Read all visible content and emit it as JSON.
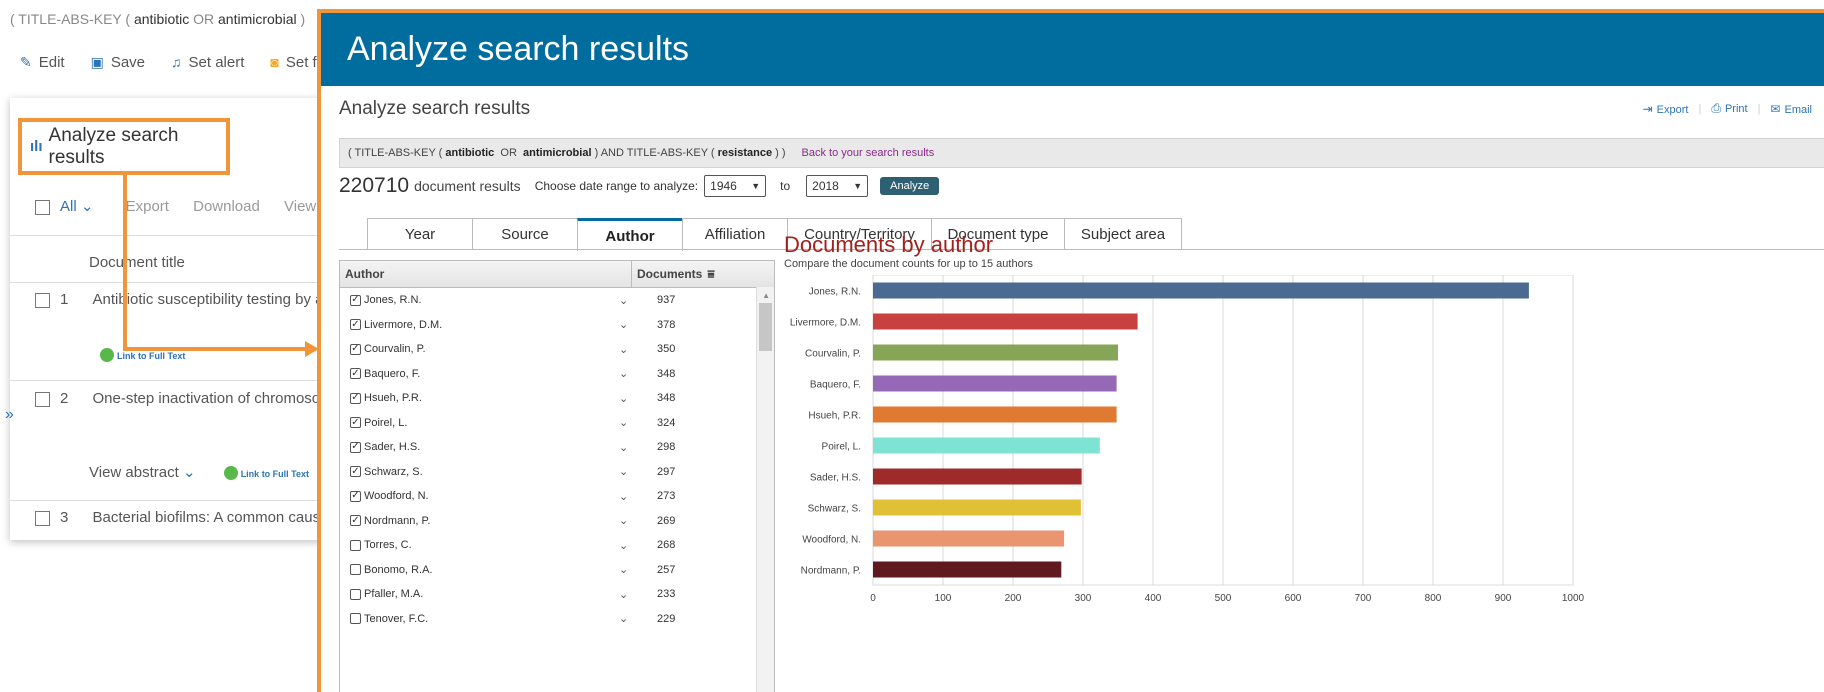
{
  "background": {
    "query_parts": [
      "( TITLE-ABS-KEY (",
      "antibiotic",
      "OR",
      "antimicrobial",
      ")"
    ],
    "toolbar": [
      {
        "icon": "pencil-icon",
        "label": "Edit"
      },
      {
        "icon": "save-icon",
        "label": "Save"
      },
      {
        "icon": "bell-icon",
        "label": "Set alert"
      },
      {
        "icon": "rss-icon",
        "label": "Set fe"
      }
    ],
    "analyze_link": "Analyze search results",
    "list_toolbar": {
      "all": "All",
      "export": "Export",
      "download": "Download",
      "view_cita": "View cita"
    },
    "column_header": "Document title",
    "docs": [
      {
        "num": "1",
        "title": "Antibiotic susceptibility testing by a s"
      },
      {
        "num": "2",
        "title": "One-step inactivation of chromosom"
      },
      {
        "num": "3",
        "title": "Bacterial biofilms: A common cause"
      }
    ],
    "view_abstract": "View abstract",
    "link_full_text": "Link to Full Text",
    "row2_extra": "F"
  },
  "modal": {
    "header": "Analyze search results",
    "subtitle": "Analyze search results",
    "actions": {
      "export": "Export",
      "print": "Print",
      "email": "Email"
    },
    "query": {
      "p1": "( TITLE-ABS-KEY (",
      "k1": "antibiotic",
      "op1": "OR",
      "k2": "antimicrobial",
      "p2": ") AND TITLE-ABS-KEY (",
      "k3": "resistance",
      "p3": ") )",
      "back": "Back to your search results"
    },
    "results_count": "220710",
    "results_label": "document results",
    "date_range_label": "Choose date range to analyze:",
    "date_from": "1946",
    "date_to_label": "to",
    "date_to": "2018",
    "analyze_button": "Analyze",
    "tabs": [
      "Year",
      "Source",
      "Author",
      "Affiliation",
      "Country/Territory",
      "Document type",
      "Subject area"
    ],
    "active_tab": "Author",
    "table": {
      "col_author": "Author",
      "col_documents": "Documents",
      "rows": [
        {
          "name": "Jones, R.N.",
          "docs": "937",
          "checked": true
        },
        {
          "name": "Livermore, D.M.",
          "docs": "378",
          "checked": true
        },
        {
          "name": "Courvalin, P.",
          "docs": "350",
          "checked": true
        },
        {
          "name": "Baquero, F.",
          "docs": "348",
          "checked": true
        },
        {
          "name": "Hsueh, P.R.",
          "docs": "348",
          "checked": true
        },
        {
          "name": "Poirel, L.",
          "docs": "324",
          "checked": true
        },
        {
          "name": "Sader, H.S.",
          "docs": "298",
          "checked": true
        },
        {
          "name": "Schwarz, S.",
          "docs": "297",
          "checked": true
        },
        {
          "name": "Woodford, N.",
          "docs": "273",
          "checked": true
        },
        {
          "name": "Nordmann, P.",
          "docs": "269",
          "checked": true
        },
        {
          "name": "Torres, C.",
          "docs": "268",
          "checked": false
        },
        {
          "name": "Bonomo, R.A.",
          "docs": "257",
          "checked": false
        },
        {
          "name": "Pfaller, M.A.",
          "docs": "233",
          "checked": false
        },
        {
          "name": "Tenover, F.C.",
          "docs": "229",
          "checked": false
        }
      ]
    },
    "chart_title": "Documents by author",
    "chart_subtitle": "Compare the document counts for up to 15 authors"
  },
  "chart_data": {
    "type": "bar",
    "orientation": "horizontal",
    "title": "Documents by author",
    "subtitle": "Compare the document counts for up to 15 authors",
    "categories": [
      "Jones, R.N.",
      "Livermore, D.M.",
      "Courvalin, P.",
      "Baquero, F.",
      "Hsueh, P.R.",
      "Poirel, L.",
      "Sader, H.S.",
      "Schwarz, S.",
      "Woodford, N.",
      "Nordmann, P."
    ],
    "values": [
      937,
      378,
      350,
      348,
      348,
      324,
      298,
      297,
      273,
      269
    ],
    "colors": [
      "#4b6a91",
      "#c8413f",
      "#87a556",
      "#9569b5",
      "#e07a31",
      "#7ee3d3",
      "#9e2a2a",
      "#e0c136",
      "#e9956f",
      "#5e1a1e"
    ],
    "xlim": [
      0,
      1000
    ],
    "xticks": [
      0,
      100,
      200,
      300,
      400,
      500,
      600,
      700,
      800,
      900,
      1000
    ],
    "grid": true
  }
}
